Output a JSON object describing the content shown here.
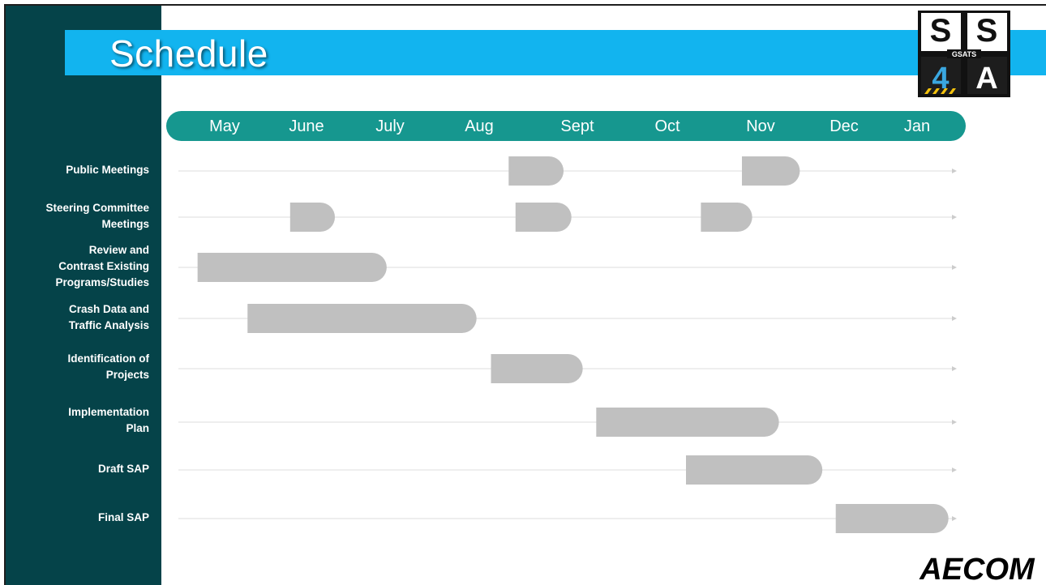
{
  "slide": {
    "title": "Schedule",
    "logo_text": {
      "top_left": "S",
      "top_right": "S",
      "center": "GSATS",
      "bottom_left": "4",
      "bottom_right": "A"
    },
    "footer_logo": "AECOM"
  },
  "colors": {
    "sidebar": "#054349",
    "title_bar": "#12b4ef",
    "month_bar": "#16978f",
    "bar": "#c0c0c0",
    "lane": "#dddddd"
  },
  "chart_data": {
    "type": "gantt",
    "months": [
      "May",
      "June",
      "July",
      "Aug",
      "Sept",
      "Oct",
      "Nov",
      "Dec",
      "Jan"
    ],
    "tasks": [
      {
        "label": "Public Meetings",
        "bars": [
          [
            3.3,
            3.86
          ],
          [
            5.8,
            6.47
          ]
        ]
      },
      {
        "label": "Steering Committee Meetings",
        "bars": [
          [
            0.8,
            1.34
          ],
          [
            3.37,
            3.94
          ],
          [
            5.36,
            5.91
          ]
        ]
      },
      {
        "label": "Review and Contrast Existing Programs/Studies",
        "bars": [
          [
            -0.33,
            1.96
          ]
        ]
      },
      {
        "label": "Crash Data and Traffic Analysis",
        "bars": [
          [
            0.28,
            2.97
          ]
        ]
      },
      {
        "label": "Identification of Projects",
        "bars": [
          [
            3.12,
            4.06
          ]
        ]
      },
      {
        "label": "Implementation Plan",
        "bars": [
          [
            4.21,
            6.22
          ]
        ]
      },
      {
        "label": "Draft SAP",
        "bars": [
          [
            5.2,
            6.74
          ]
        ]
      },
      {
        "label": "Final SAP",
        "bars": [
          [
            6.9,
            8.43
          ]
        ]
      }
    ]
  }
}
